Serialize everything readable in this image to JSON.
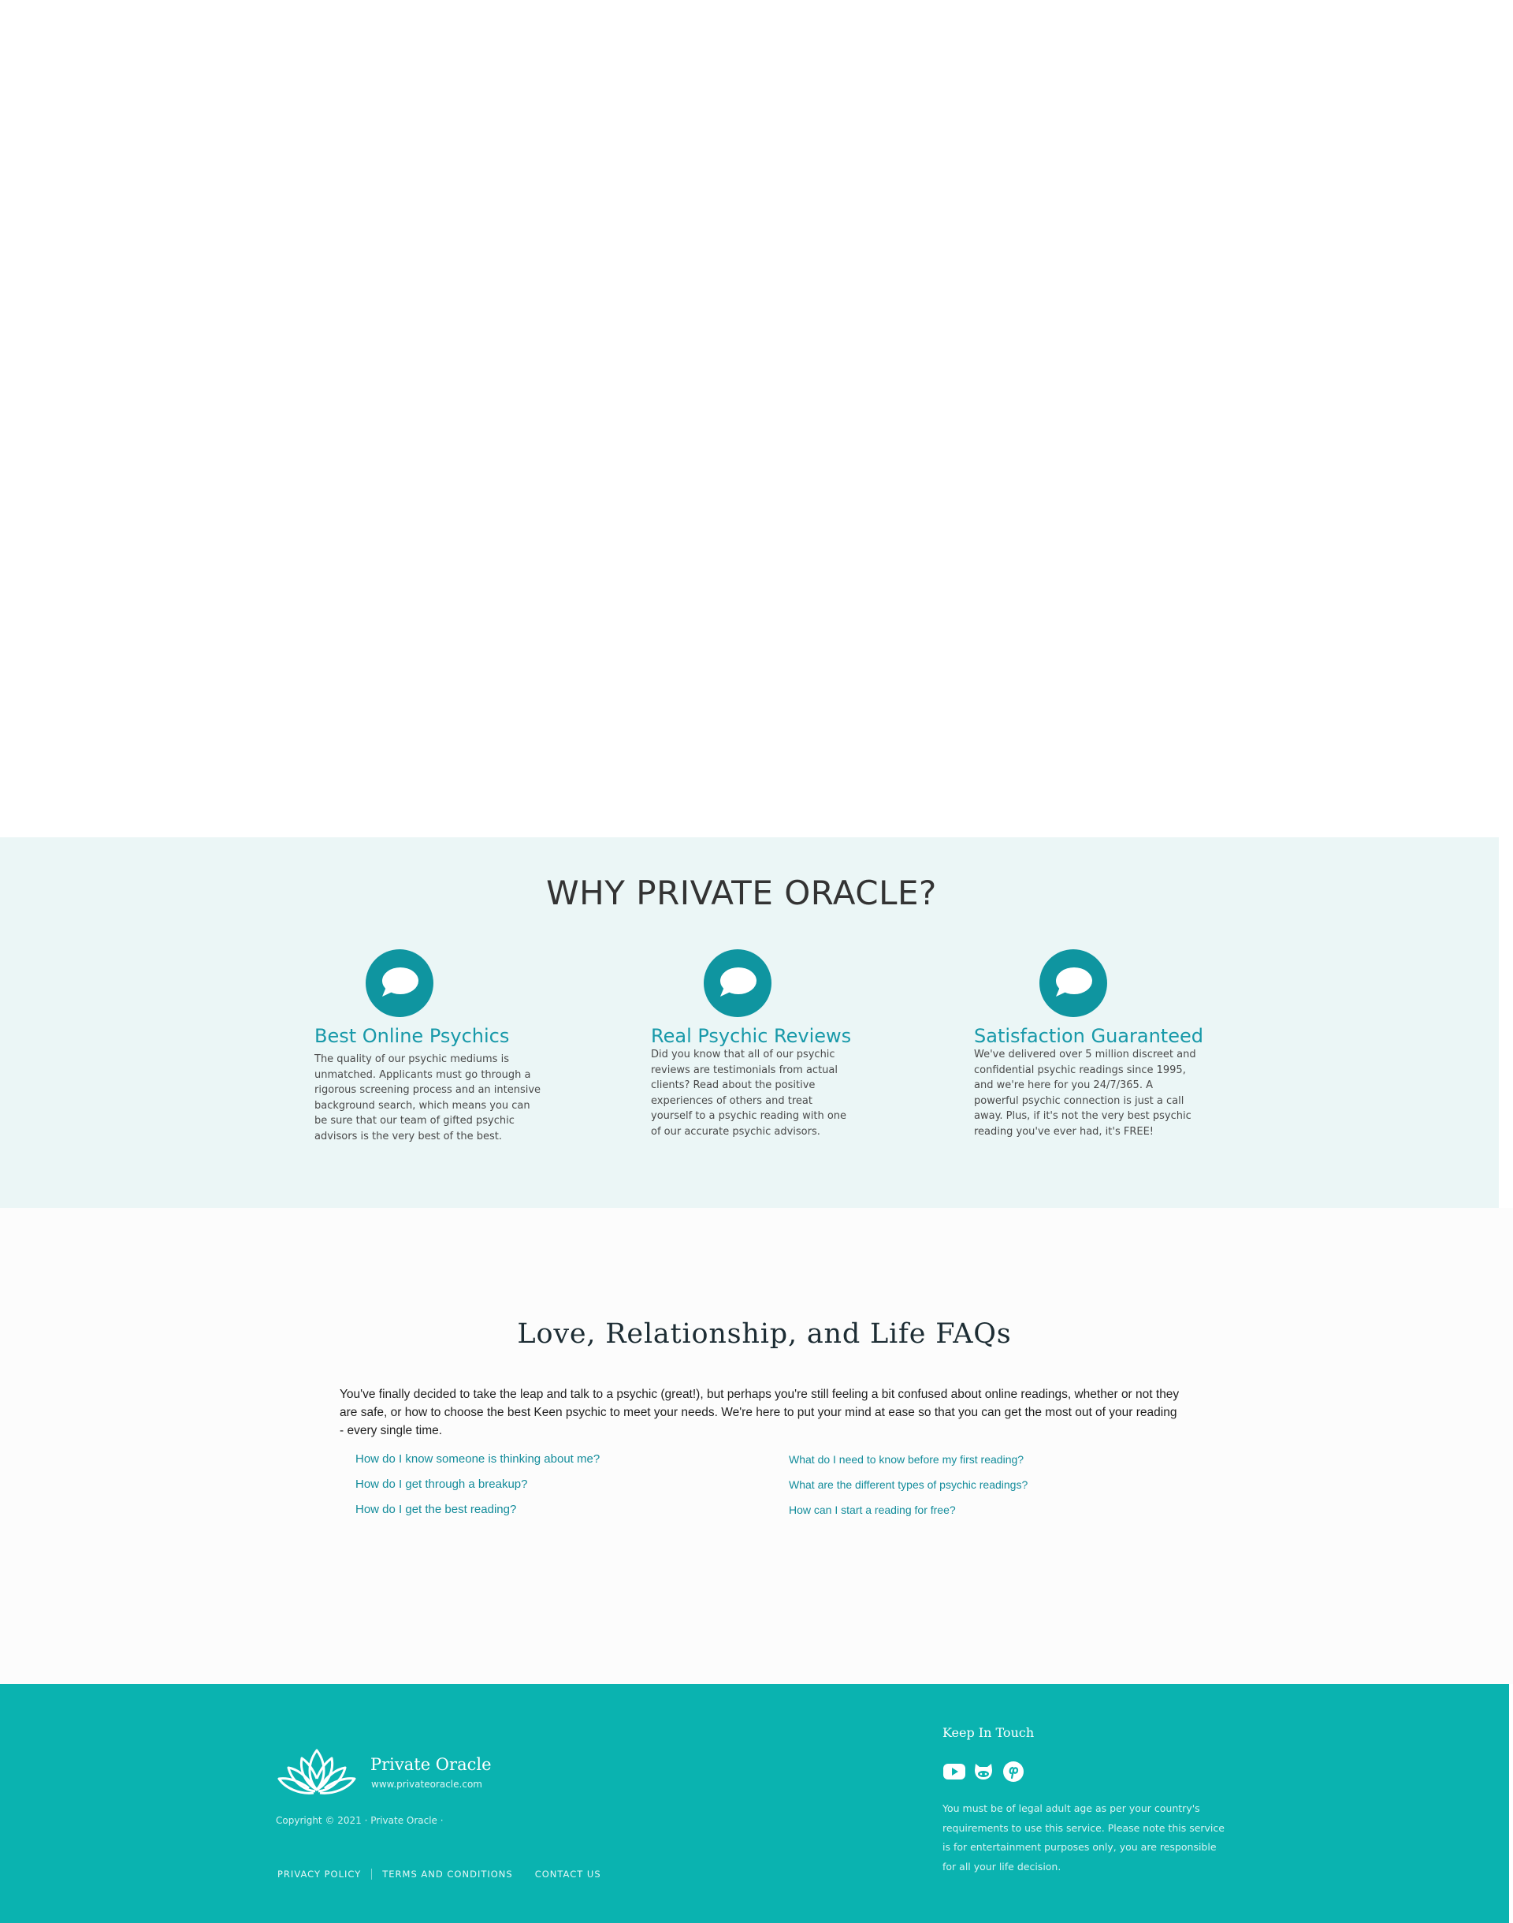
{
  "why": {
    "title": "WHY PRIVATE ORACLE?",
    "features": [
      {
        "icon": "chat-bubble-icon",
        "title": "Best Online Psychics",
        "text": "The quality of our psychic mediums is unmatched. Applicants must go through a rigorous screening process and an intensive background search, which means you can be sure that our team of gifted psychic advisors is the very best of the best."
      },
      {
        "icon": "chat-bubble-icon",
        "title": "Real Psychic Reviews",
        "text": "Did you know that all of our psychic reviews are testimonials from actual clients? Read about the positive experiences of others and treat yourself to a psychic reading with one of our accurate psychic advisors."
      },
      {
        "icon": "chat-bubble-icon",
        "title": "Satisfaction Guaranteed",
        "text": "We've delivered over 5 million discreet and confidential psychic readings since 1995, and we're here for you 24/7/365. A powerful psychic connection is just a call away. Plus, if it's not the very best psychic reading you've ever had, it's FREE!"
      }
    ]
  },
  "faq": {
    "title": "Love, Relationship, and Life FAQs",
    "intro": "You've finally decided to take the leap and talk to a psychic (great!), but perhaps you're still feeling a bit confused about online readings, whether or not they are safe, or how to choose the best Keen psychic to meet your needs. We're here to put your mind at ease so that you can get the most out of your reading - every single time.",
    "left_links": [
      "How do I know someone is thinking about me?",
      "How do I get through a breakup?",
      "How do I get the best reading?"
    ],
    "right_links": [
      "What do I need to know before my first reading?",
      "What are the different types of psychic readings?",
      "How can I start a reading for free?"
    ]
  },
  "footer": {
    "brand_name": "Private Oracle",
    "brand_url": "www.privateoracle.com",
    "copyright": "Copyright © 2021 · Private Oracle ·",
    "links": [
      "PRIVACY POLICY",
      "TERMS AND CONDITIONS",
      "CONTACT US"
    ],
    "keep_in_touch": "Keep In Touch",
    "social_icons": [
      "youtube-icon",
      "github-icon",
      "pinterest-icon"
    ],
    "disclaimer": "You must be of legal adult age as per your country's requirements to use this service. Please note this service is for entertainment purposes only, you are responsible for all your life decision."
  },
  "colors": {
    "accent": "#0f95a0",
    "section_bg": "#ebf6f6",
    "footer_bg": "#0ab3b0",
    "link": "#138c9b"
  }
}
